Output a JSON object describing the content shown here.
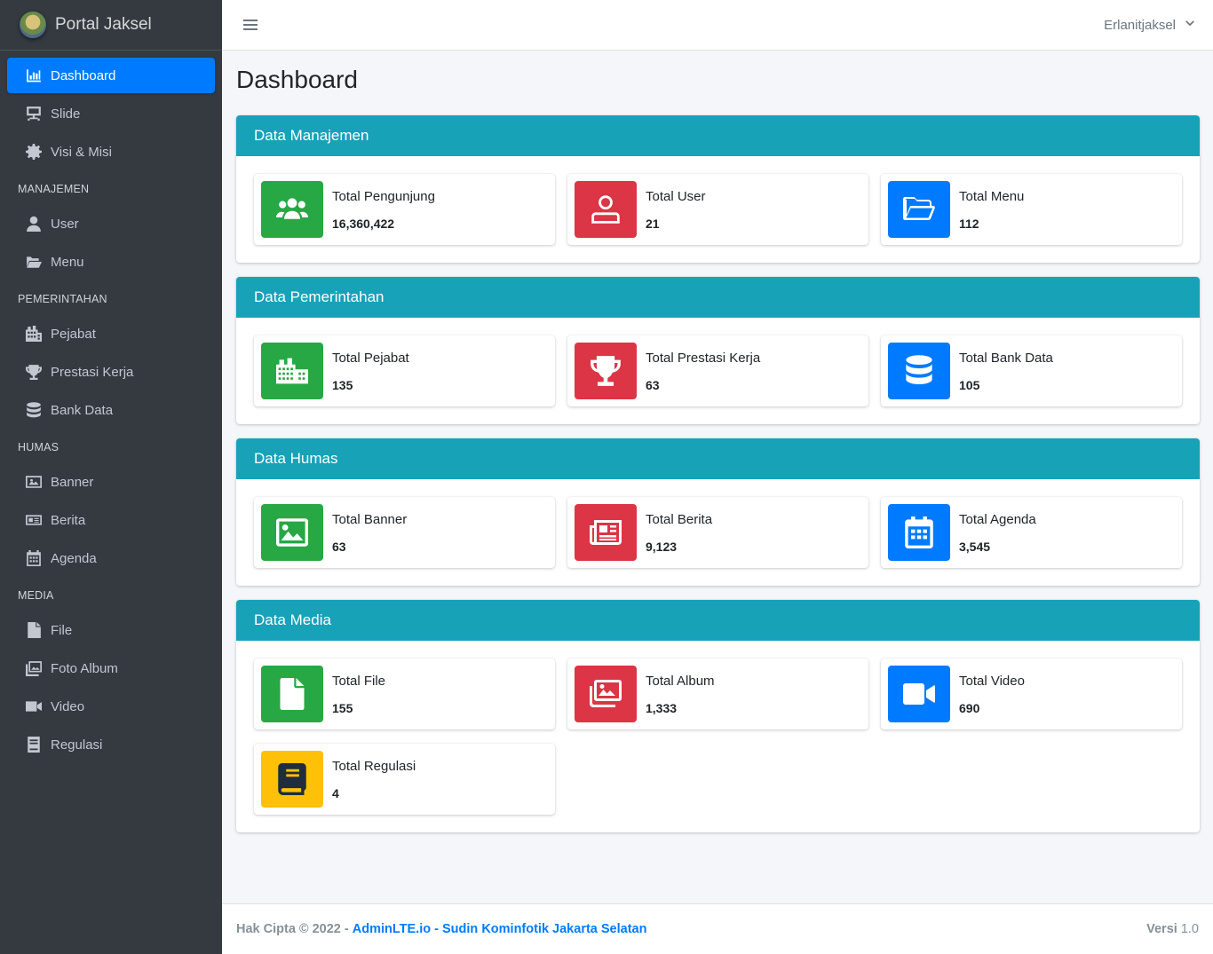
{
  "brand": {
    "title": "Portal Jaksel"
  },
  "sidebar": {
    "items": [
      {
        "label": "Dashboard",
        "icon": "chart-bar-icon",
        "active": true
      },
      {
        "label": "Slide",
        "icon": "slideshow-icon"
      },
      {
        "label": "Visi & Misi",
        "icon": "gear-icon"
      }
    ],
    "sections": [
      {
        "header": "MANAJEMEN",
        "items": [
          {
            "label": "User",
            "icon": "user-icon"
          },
          {
            "label": "Menu",
            "icon": "folder-open-icon"
          }
        ]
      },
      {
        "header": "PEMERINTAHAN",
        "items": [
          {
            "label": "Pejabat",
            "icon": "building-icon"
          },
          {
            "label": "Prestasi Kerja",
            "icon": "trophy-icon"
          },
          {
            "label": "Bank Data",
            "icon": "database-icon"
          }
        ]
      },
      {
        "header": "HUMAS",
        "items": [
          {
            "label": "Banner",
            "icon": "image-icon"
          },
          {
            "label": "Berita",
            "icon": "newspaper-icon"
          },
          {
            "label": "Agenda",
            "icon": "calendar-icon"
          }
        ]
      },
      {
        "header": "MEDIA",
        "items": [
          {
            "label": "File",
            "icon": "file-icon"
          },
          {
            "label": "Foto Album",
            "icon": "images-icon"
          },
          {
            "label": "Video",
            "icon": "video-icon"
          },
          {
            "label": "Regulasi",
            "icon": "book-icon"
          }
        ]
      }
    ]
  },
  "navbar": {
    "user": "Erlanitjaksel"
  },
  "page": {
    "title": "Dashboard"
  },
  "cards": [
    {
      "title": "Data Manajemen",
      "boxes": [
        {
          "label": "Total Pengunjung",
          "value": "16,360,422",
          "color": "#28a745",
          "icon": "users-icon"
        },
        {
          "label": "Total User",
          "value": "21",
          "color": "#dc3545",
          "icon": "user-icon"
        },
        {
          "label": "Total Menu",
          "value": "112",
          "color": "#007bff",
          "icon": "folder-open-icon"
        }
      ]
    },
    {
      "title": "Data Pemerintahan",
      "boxes": [
        {
          "label": "Total Pejabat",
          "value": "135",
          "color": "#28a745",
          "icon": "building-icon"
        },
        {
          "label": "Total Prestasi Kerja",
          "value": "63",
          "color": "#dc3545",
          "icon": "trophy-icon"
        },
        {
          "label": "Total Bank Data",
          "value": "105",
          "color": "#007bff",
          "icon": "database-icon"
        }
      ]
    },
    {
      "title": "Data Humas",
      "boxes": [
        {
          "label": "Total Banner",
          "value": "63",
          "color": "#28a745",
          "icon": "image-icon"
        },
        {
          "label": "Total Berita",
          "value": "9,123",
          "color": "#dc3545",
          "icon": "newspaper-icon"
        },
        {
          "label": "Total Agenda",
          "value": "3,545",
          "color": "#007bff",
          "icon": "calendar-icon"
        }
      ]
    },
    {
      "title": "Data Media",
      "boxes": [
        {
          "label": "Total File",
          "value": "155",
          "color": "#28a745",
          "icon": "file-icon"
        },
        {
          "label": "Total Album",
          "value": "1,333",
          "color": "#dc3545",
          "icon": "images-icon"
        },
        {
          "label": "Total Video",
          "value": "690",
          "color": "#007bff",
          "icon": "video-icon"
        },
        {
          "label": "Total Regulasi",
          "value": "4",
          "color": "#ffc107",
          "icon": "book-icon"
        }
      ]
    }
  ],
  "footer": {
    "prefix": "Hak Cipta © 2022 -",
    "link1": "AdminLTE.io",
    "sep": "-",
    "link2": "Sudin Kominfotik Jakarta Selatan",
    "version_label": "Versi",
    "version": "1.0"
  }
}
